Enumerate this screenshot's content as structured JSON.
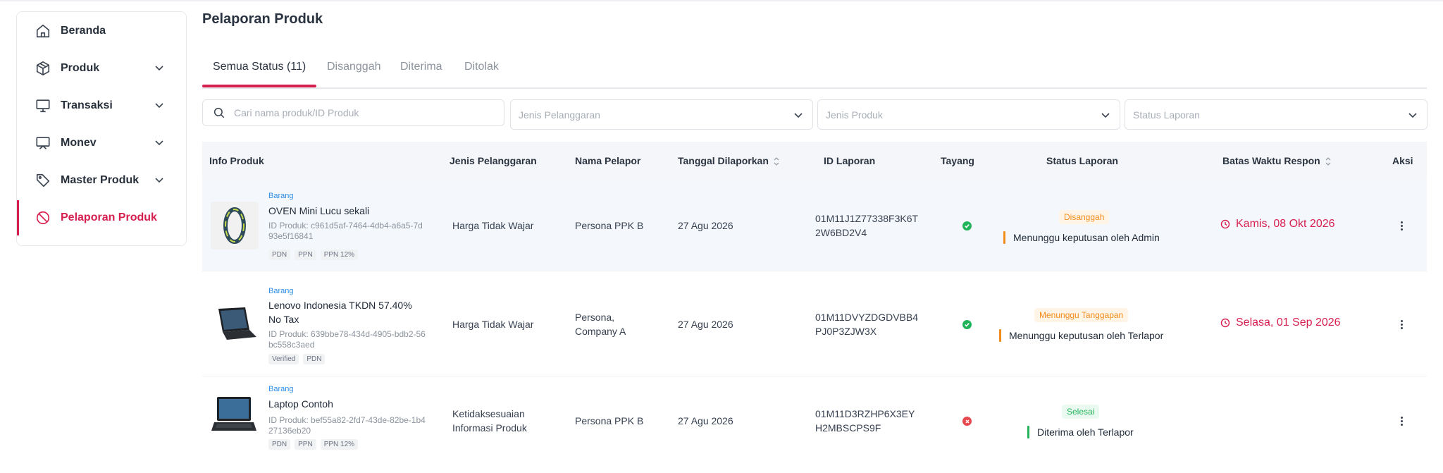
{
  "sidebar": {
    "items": [
      {
        "label": "Beranda"
      },
      {
        "label": "Produk"
      },
      {
        "label": "Transaksi"
      },
      {
        "label": "Monev"
      },
      {
        "label": "Master Produk"
      },
      {
        "label": "Pelaporan Produk"
      }
    ]
  },
  "page": {
    "title": "Pelaporan Produk"
  },
  "tabs": [
    {
      "label": "Semua Status (11)"
    },
    {
      "label": "Disanggah"
    },
    {
      "label": "Diterima"
    },
    {
      "label": "Ditolak"
    }
  ],
  "filters": {
    "search_placeholder": "Cari nama produk/ID Produk",
    "customer_type": "Jenis Pelanggaran",
    "product_type": "Jenis Produk",
    "report_status": "Status Laporan"
  },
  "table": {
    "headers": [
      "Info Produk",
      "Jenis Pelanggaran",
      "Nama Pelapor",
      "Tanggal Dilaporkan",
      "ID Laporan",
      "Tayang",
      "Status Laporan",
      "Batas Waktu Respon",
      "Aksi"
    ],
    "rows": [
      {
        "type": "Barang",
        "name": "OVEN Mini Lucu sekali",
        "product_id": "ID Produk: c961d5af-7464-4db4-a6a5-7d93e5f16841",
        "badges": [
          "PDN",
          "PPN",
          "PPN 12%"
        ],
        "violation": "Harga Tidak Wajar",
        "reporter": "Persona PPK B",
        "date": "27 Agu 2026",
        "report_id": "01M11J1Z77338F3K6T2W6BD2V4",
        "tayang": "yes",
        "status": "Disanggah",
        "status_color": "#f28c1c",
        "status_desc": "Menunggu keputusan oleh Admin",
        "deadline": "Kamis, 08 Okt 2026"
      },
      {
        "type": "Barang",
        "name": "Lenovo Indonesia TKDN 57.40% No Tax",
        "product_id": "ID Produk: 639bbe78-434d-4905-bdb2-56bc558c3aed",
        "badges": [
          "Verified",
          "PDN"
        ],
        "violation": "Harga Tidak Wajar",
        "reporter": "Persona, Company A",
        "date": "27 Agu 2026",
        "report_id": "01M11DVYZDGDVBB4PJ0P3ZJW3X",
        "tayang": "yes",
        "status": "Menunggu Tanggapan",
        "status_color": "#f28c1c",
        "status_desc": "Menunggu keputusan oleh Terlapor",
        "deadline": "Selasa, 01 Sep 2026"
      },
      {
        "type": "Barang",
        "name": "Laptop Contoh",
        "product_id": "ID Produk: bef55a82-2fd7-43de-82be-1b427136eb20",
        "badges": [
          "PDN",
          "PPN",
          "PPN 12%"
        ],
        "violation": "Ketidaksesuaian Informasi Produk",
        "reporter": "Persona PPK B",
        "date": "27 Agu 2026",
        "report_id": "01M11D3RZHP6X3EYH2MBSCPS9F",
        "tayang": "no",
        "status": "Selesai",
        "status_color": "#22b45a",
        "status_desc": "Diterima oleh Terlapor",
        "deadline": ""
      }
    ]
  },
  "colors": {
    "accent": "#d61f4f",
    "success": "#22b45a",
    "error": "#e5484d",
    "warning": "#f28c1c"
  }
}
